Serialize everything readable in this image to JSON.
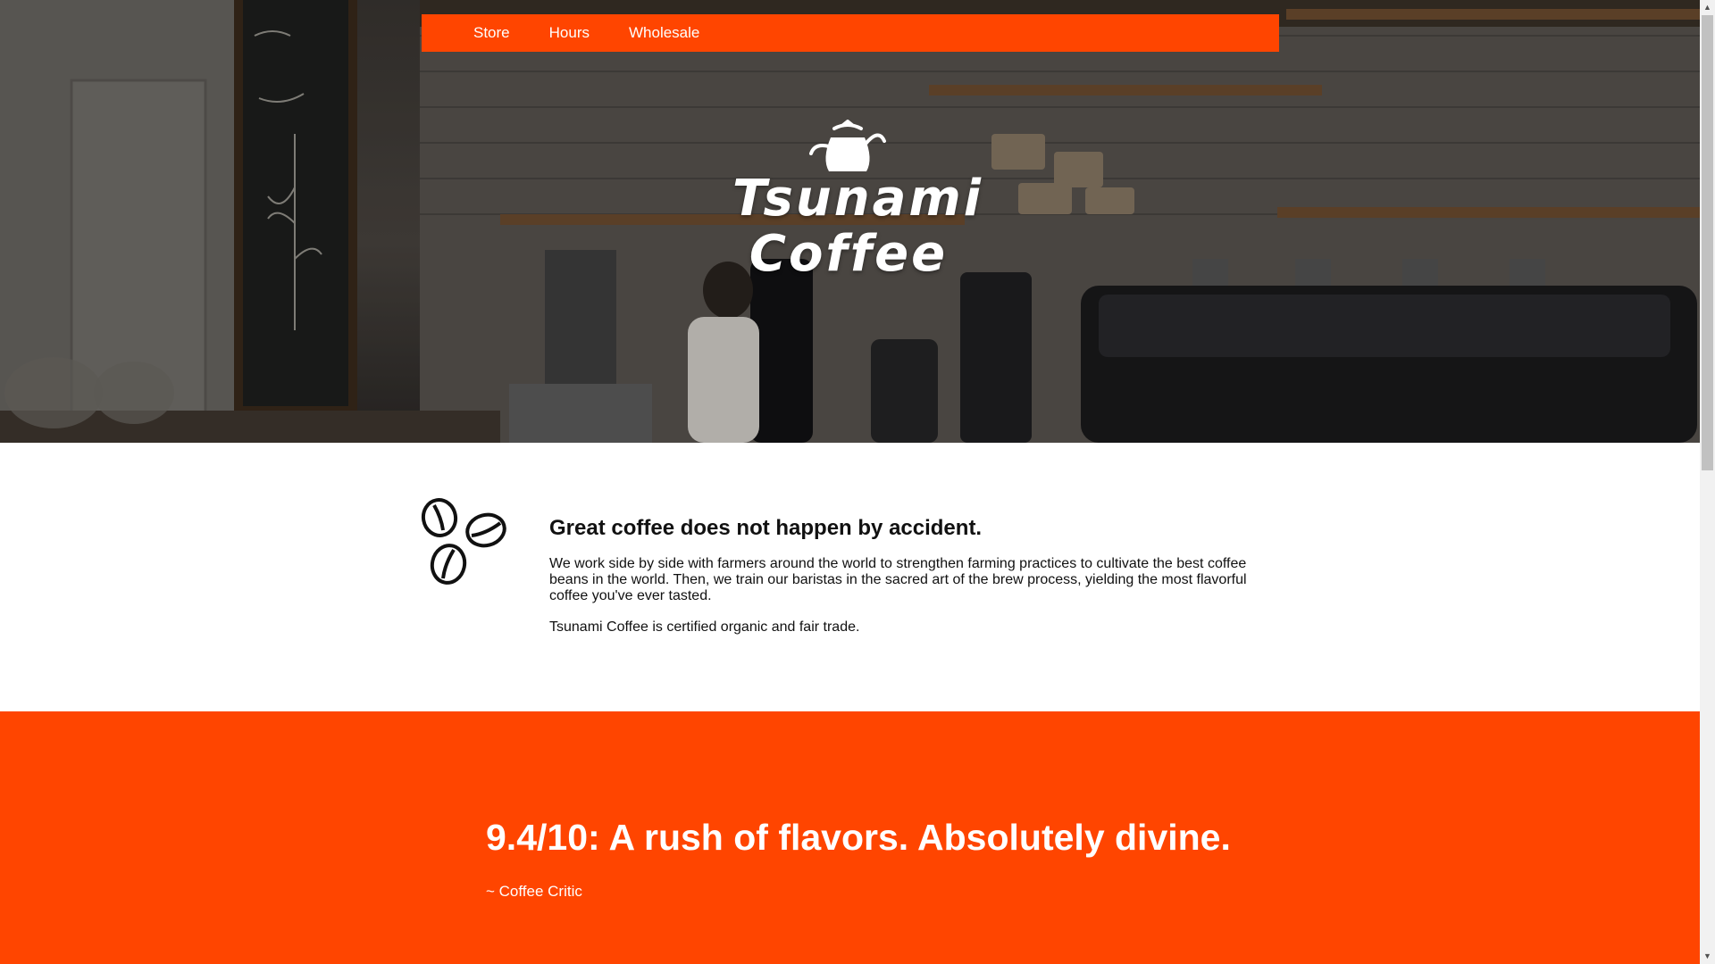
{
  "nav": {
    "items": [
      {
        "label": "Store"
      },
      {
        "label": "Hours"
      },
      {
        "label": "Wholesale"
      }
    ],
    "color": "#ff4500"
  },
  "logo": {
    "line1": "Tsunami",
    "line2": "Coffee",
    "icon": "kettle-icon"
  },
  "about": {
    "icon": "coffee-beans-icon",
    "heading": "Great coffee does not happen by accident.",
    "paragraph1": "We work side by side with farmers around the world to strengthen farming practices to cultivate the best coffee beans in the world. Then, we train our baristas in the sacred art of the brew process, yielding the most flavorful coffee you've ever tasted.",
    "paragraph2": "Tsunami Coffee is certified organic and fair trade."
  },
  "review": {
    "quote": "9.4/10: A rush of flavors. Absolutely divine.",
    "author": "~ Coffee Critic",
    "color": "#ff4500"
  }
}
